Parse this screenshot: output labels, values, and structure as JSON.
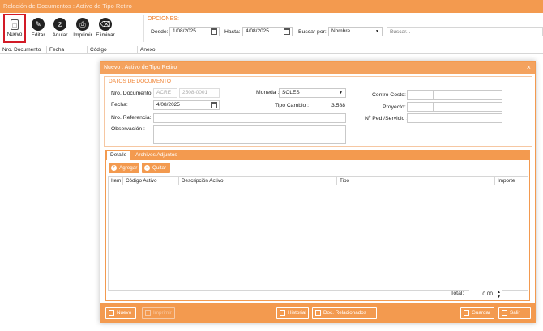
{
  "window_title": "Relación de Documentos : Activo de Tipo Retiro",
  "toolbar": {
    "nuevo": "Nuevo",
    "editar": "Editar",
    "anular": "Anular",
    "imprimir": "Imprimir",
    "eliminar": "Eliminar"
  },
  "opciones": {
    "title": "OPCIONES:",
    "desde_label": "Desde:",
    "desde_value": "1/08/2025",
    "hasta_label": "Hasta:",
    "hasta_value": "4/08/2025",
    "buscar_por_label": "Buscar por:",
    "buscar_por_value": "Nombre",
    "search_placeholder": "Buscar..."
  },
  "grid_columns": [
    "Nro. Documento",
    "Fecha",
    "Código",
    "Anexo"
  ],
  "modal": {
    "title": "Nuevo : Activo de Tipo Retiro",
    "close": "×",
    "section_title": "DATOS DE DOCUMENTO",
    "nro_documento_label": "Nro. Documento:",
    "nro_serie": "ACRE",
    "nro_numero": "2508-0001",
    "fecha_label": "Fecha:",
    "fecha_value": "4/08/2025",
    "nro_referencia_label": "Nro. Referencia:",
    "observacion_label": "Observación :",
    "moneda_label": "Moneda :",
    "moneda_value": "SOLES",
    "tipo_cambio_label": "Tipo Cambio :",
    "tipo_cambio_value": "3.588",
    "centro_costo_label": "Centro Costo:",
    "proyecto_label": "Proyecto:",
    "ped_servicio_label": "Nº Ped./Servicio :",
    "tabs": [
      "Detalle",
      "Archivos Adjuntos"
    ],
    "agregar": "Agregar",
    "quitar": "Quitar",
    "detail_columns": [
      "Item",
      "Código Activo",
      "Descripción Activo",
      "Tipo",
      "Importe"
    ],
    "total_label": "Total:",
    "total_value": "0.00",
    "footer": {
      "nuevo": "Nuevo",
      "imprimir": "Imprimir",
      "historial": "Historial",
      "doc_relacionados": "Doc. Relacionados",
      "guardar": "Guardar",
      "salir": "Salir"
    }
  }
}
